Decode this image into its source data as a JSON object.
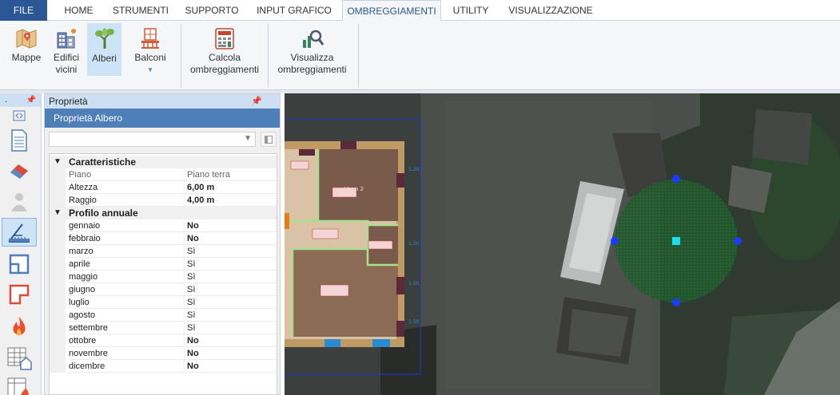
{
  "menu": {
    "file": "FILE",
    "tabs": [
      "HOME",
      "STRUMENTI",
      "SUPPORTO",
      "INPUT GRAFICO",
      "OMBREGGIAMENTI",
      "UTILITY",
      "VISUALIZZAZIONE"
    ],
    "active_tab": "OMBREGGIAMENTI"
  },
  "ribbon": {
    "mappe": "Mappe",
    "edifici_1": "Edifici",
    "edifici_2": "vicini",
    "alberi": "Alberi",
    "balconi": "Balconi",
    "calcola_1": "Calcola",
    "calcola_2": "ombreggiamenti",
    "visualizza_1": "Visualizza",
    "visualizza_2": "ombreggiamenti"
  },
  "toolstrip": {
    "header": ".",
    "pin": "✓"
  },
  "properties": {
    "panel_title": "Proprietà",
    "pin": "✓",
    "section_title": "Proprietà Albero",
    "category_1": "Caratteristiche",
    "category_2": "Profilo annuale",
    "rows": [
      {
        "key": "Piano",
        "value": "Piano terra"
      },
      {
        "key": "Altezza",
        "value": "6,00 m"
      },
      {
        "key": "Raggio",
        "value": "4,00 m"
      }
    ],
    "months": [
      {
        "key": "gennaio",
        "value": "No"
      },
      {
        "key": "febbraio",
        "value": "No"
      },
      {
        "key": "marzo",
        "value": "Sì"
      },
      {
        "key": "aprile",
        "value": "Sì"
      },
      {
        "key": "maggio",
        "value": "Sì"
      },
      {
        "key": "giugno",
        "value": "Sì"
      },
      {
        "key": "luglio",
        "value": "Sì"
      },
      {
        "key": "agosto",
        "value": "Sì"
      },
      {
        "key": "settembre",
        "value": "Sì"
      },
      {
        "key": "ottobre",
        "value": "No"
      },
      {
        "key": "novembre",
        "value": "No"
      },
      {
        "key": "dicembre",
        "value": "No"
      }
    ]
  },
  "canvas": {
    "room_label": "Vano 2",
    "scale_1": "1.20",
    "scale_2": "1.50",
    "scale_3": "1.50",
    "scale_4": "1.50"
  },
  "colors": {
    "file_tab": "#2b5797",
    "selection": "#cde4f7",
    "panel_header": "#4e7fb8",
    "tree_fill": "#2f7a3d",
    "handle": "#1a3cff",
    "center_handle": "#19e0f0"
  }
}
